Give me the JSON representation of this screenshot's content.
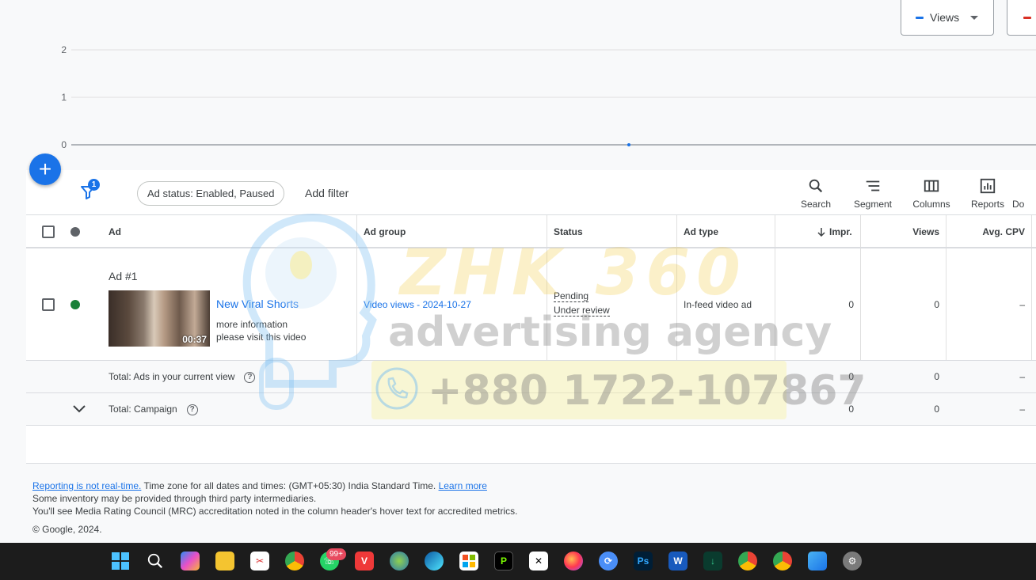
{
  "chart": {
    "metric_selector": "Views",
    "y_ticks": [
      "2",
      "1",
      "0"
    ]
  },
  "chart_data": {
    "type": "line",
    "series": [
      {
        "name": "Views",
        "values": [
          0
        ]
      }
    ],
    "ylim": [
      0,
      2
    ],
    "grid": true,
    "color": "#1a73e8"
  },
  "toolbar": {
    "filter_badge": "1",
    "status_chip": "Ad status: Enabled, Paused",
    "add_filter": "Add filter",
    "tools": [
      {
        "label": "Search",
        "icon": "search-icon"
      },
      {
        "label": "Segment",
        "icon": "segment-icon"
      },
      {
        "label": "Columns",
        "icon": "columns-icon"
      },
      {
        "label": "Reports",
        "icon": "reports-icon"
      },
      {
        "label": "Do",
        "icon": "download-icon"
      }
    ]
  },
  "table": {
    "headers": {
      "ad": "Ad",
      "ad_group": "Ad group",
      "status": "Status",
      "ad_type": "Ad type",
      "impr": "Impr.",
      "views": "Views",
      "avg_cpv": "Avg. CPV"
    },
    "rows": [
      {
        "ad_number": "Ad #1",
        "title": "New Viral Shorts",
        "desc1": "more information",
        "desc2": "please visit this video",
        "duration": "00:37",
        "ad_group": "Video views - 2024-10-27",
        "status1": "Pending",
        "status2": "Under review",
        "ad_type": "In-feed video ad",
        "impr": "0",
        "views": "0",
        "avg_cpv": "–",
        "status_color": "#188038"
      }
    ],
    "total_view": {
      "label": "Total: Ads in your current view",
      "impr": "0",
      "views": "0",
      "avg_cpv": "–"
    },
    "total_campaign": {
      "label": "Total: Campaign",
      "impr": "0",
      "views": "0",
      "avg_cpv": "–"
    }
  },
  "watermark": {
    "title": "ZHK 360",
    "subtitle": "advertising agency",
    "phone": "+880 1722-107867"
  },
  "footer": {
    "link1": "Reporting is not real-time.",
    "text1": " Time zone for all dates and times: (GMT+05:30) India Standard Time. ",
    "link2": "Learn more",
    "line2": "Some inventory may be provided through third party intermediaries.",
    "line3": "You'll see Media Rating Council (MRC) accreditation noted in the column header's hover text for accredited metrics.",
    "copyright": "© Google, 2024."
  },
  "taskbar": {
    "badge": "99+"
  }
}
